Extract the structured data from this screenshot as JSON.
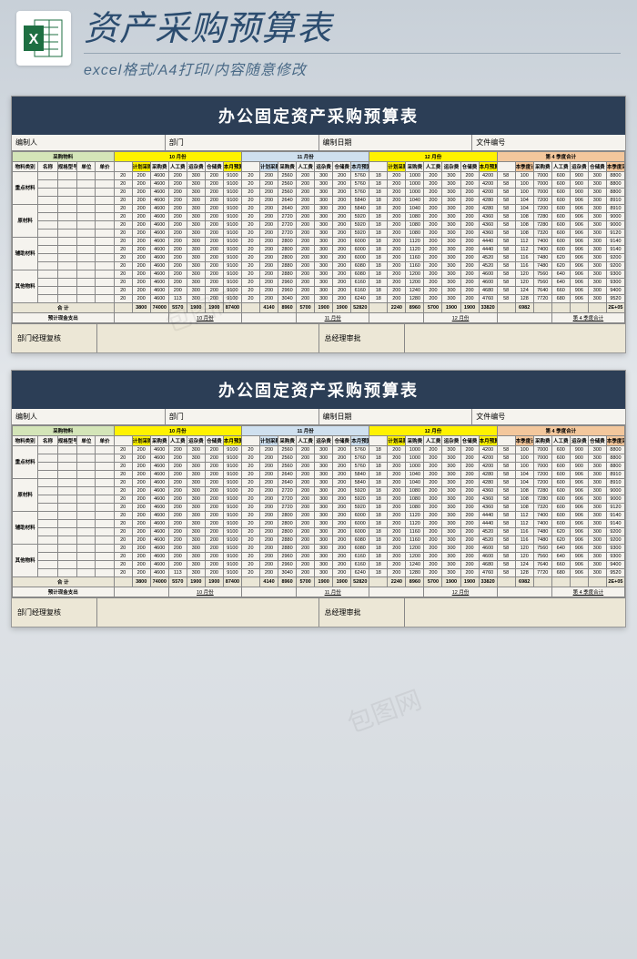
{
  "header": {
    "title_main": "资产采购预算表",
    "title_sub": "excel格式/A4打印/内容随意修改"
  },
  "sheet": {
    "title": "办公固定资产采购预算表",
    "info_labels": [
      "编制人",
      "部门",
      "编制日期",
      "文件编号"
    ],
    "group_header_left": "采购物料",
    "month_headers": [
      "10  月份",
      "11  月份",
      "12  月份",
      "第  4  季度合计"
    ],
    "left_cols": [
      "物料类别",
      "名称",
      "规格型号",
      "单位",
      "单价"
    ],
    "metric_cols_month": [
      "计划采购量",
      "采购费",
      "人工费",
      "运杂费",
      "仓储费",
      "本月预算小计"
    ],
    "metric_cols_quarter": [
      "本季度计划采购量",
      "采购费",
      "人工费",
      "运杂费",
      "仓储费",
      "本季度采购预算合计"
    ],
    "categories": [
      "重点材料",
      "原材料",
      "辅助材料",
      "其他物料"
    ],
    "rows": [
      {
        "cat": 0,
        "v": [
          20,
          200,
          4600,
          200,
          300,
          200,
          9100,
          20,
          200,
          2560,
          200,
          300,
          200,
          5760,
          18,
          200,
          1000,
          200,
          300,
          200,
          4200,
          58,
          100,
          7000,
          600,
          900,
          300,
          8800
        ]
      },
      {
        "cat": 0,
        "v": [
          20,
          200,
          4600,
          200,
          300,
          200,
          9100,
          20,
          200,
          2560,
          200,
          300,
          200,
          5760,
          18,
          200,
          1000,
          200,
          300,
          200,
          4200,
          58,
          100,
          7000,
          600,
          900,
          300,
          8800
        ]
      },
      {
        "cat": 0,
        "v": [
          20,
          200,
          4600,
          200,
          300,
          200,
          9100,
          20,
          200,
          2560,
          200,
          300,
          200,
          5760,
          18,
          200,
          1000,
          200,
          300,
          200,
          4200,
          58,
          100,
          7000,
          600,
          900,
          300,
          8800
        ]
      },
      {
        "cat": 0,
        "v": [
          20,
          200,
          4600,
          200,
          300,
          200,
          9100,
          20,
          200,
          2640,
          200,
          300,
          200,
          5840,
          18,
          200,
          1040,
          200,
          300,
          200,
          4280,
          58,
          104,
          7200,
          600,
          906,
          300,
          8910
        ]
      },
      {
        "cat": 1,
        "v": [
          20,
          200,
          4600,
          200,
          300,
          200,
          9100,
          20,
          200,
          2640,
          200,
          300,
          200,
          5840,
          18,
          200,
          1040,
          200,
          300,
          200,
          4280,
          58,
          104,
          7200,
          600,
          906,
          300,
          8910
        ]
      },
      {
        "cat": 1,
        "v": [
          20,
          200,
          4600,
          200,
          300,
          200,
          9100,
          20,
          200,
          2720,
          200,
          300,
          200,
          5920,
          18,
          200,
          1080,
          200,
          300,
          200,
          4360,
          58,
          108,
          7280,
          600,
          906,
          300,
          9000
        ]
      },
      {
        "cat": 1,
        "v": [
          20,
          200,
          4600,
          200,
          300,
          200,
          9100,
          20,
          200,
          2720,
          200,
          300,
          200,
          5920,
          18,
          200,
          1080,
          200,
          300,
          200,
          4360,
          58,
          108,
          7280,
          600,
          906,
          300,
          9000
        ]
      },
      {
        "cat": 1,
        "v": [
          20,
          200,
          4600,
          200,
          300,
          200,
          9100,
          20,
          200,
          2720,
          200,
          300,
          200,
          5920,
          18,
          200,
          1080,
          200,
          300,
          200,
          4360,
          58,
          108,
          7320,
          600,
          906,
          300,
          9120
        ]
      },
      {
        "cat": 2,
        "v": [
          20,
          200,
          4600,
          200,
          300,
          200,
          9100,
          20,
          200,
          2800,
          200,
          300,
          200,
          6000,
          18,
          200,
          1120,
          200,
          300,
          200,
          4440,
          58,
          112,
          7400,
          600,
          906,
          300,
          9140
        ]
      },
      {
        "cat": 2,
        "v": [
          20,
          200,
          4600,
          200,
          300,
          200,
          9100,
          20,
          200,
          2800,
          200,
          300,
          200,
          6000,
          18,
          200,
          1120,
          200,
          300,
          200,
          4440,
          58,
          112,
          7400,
          600,
          906,
          300,
          9140
        ]
      },
      {
        "cat": 2,
        "v": [
          20,
          200,
          4600,
          200,
          300,
          200,
          9100,
          20,
          200,
          2800,
          200,
          300,
          200,
          6000,
          18,
          200,
          1160,
          200,
          300,
          200,
          4520,
          58,
          116,
          7480,
          620,
          906,
          300,
          9200
        ]
      },
      {
        "cat": 2,
        "v": [
          20,
          200,
          4600,
          200,
          300,
          200,
          9100,
          20,
          200,
          2880,
          200,
          300,
          200,
          6080,
          18,
          200,
          1160,
          200,
          300,
          200,
          4520,
          58,
          116,
          7480,
          620,
          906,
          300,
          9200
        ]
      },
      {
        "cat": 3,
        "v": [
          20,
          200,
          4600,
          200,
          300,
          200,
          9100,
          20,
          200,
          2880,
          200,
          300,
          200,
          6080,
          18,
          200,
          1200,
          200,
          300,
          200,
          4600,
          58,
          120,
          7560,
          640,
          906,
          300,
          9300
        ]
      },
      {
        "cat": 3,
        "v": [
          20,
          200,
          4600,
          200,
          300,
          200,
          9100,
          20,
          200,
          2960,
          200,
          300,
          200,
          6160,
          18,
          200,
          1200,
          200,
          300,
          200,
          4600,
          58,
          120,
          7560,
          640,
          906,
          300,
          9300
        ]
      },
      {
        "cat": 3,
        "v": [
          20,
          200,
          4600,
          200,
          300,
          200,
          9100,
          20,
          200,
          2960,
          200,
          300,
          200,
          6160,
          18,
          200,
          1240,
          200,
          300,
          200,
          4680,
          58,
          124,
          7640,
          660,
          906,
          300,
          9400
        ]
      },
      {
        "cat": 3,
        "v": [
          20,
          200,
          4600,
          113,
          300,
          200,
          9100,
          20,
          200,
          3040,
          200,
          300,
          200,
          6240,
          18,
          200,
          1280,
          200,
          300,
          200,
          4760,
          58,
          128,
          7720,
          680,
          906,
          300,
          9520
        ]
      }
    ],
    "sum_label": "合  计",
    "sum_row": [
      "",
      3800,
      74000,
      5570,
      1900,
      1900,
      87400,
      "",
      4140,
      8960,
      5700,
      1900,
      1900,
      52820,
      "",
      2240,
      8960,
      5700,
      1900,
      1900,
      33820,
      "",
      6982,
      "",
      "",
      "",
      "",
      "2E+05"
    ],
    "cash_row_label": "预计现金支出",
    "cash_months": [
      "10  月份",
      "11  月份",
      "12  月份",
      "第  4  季度合计"
    ],
    "footer_left": "部门经理复核",
    "footer_right": "总经理审批"
  }
}
